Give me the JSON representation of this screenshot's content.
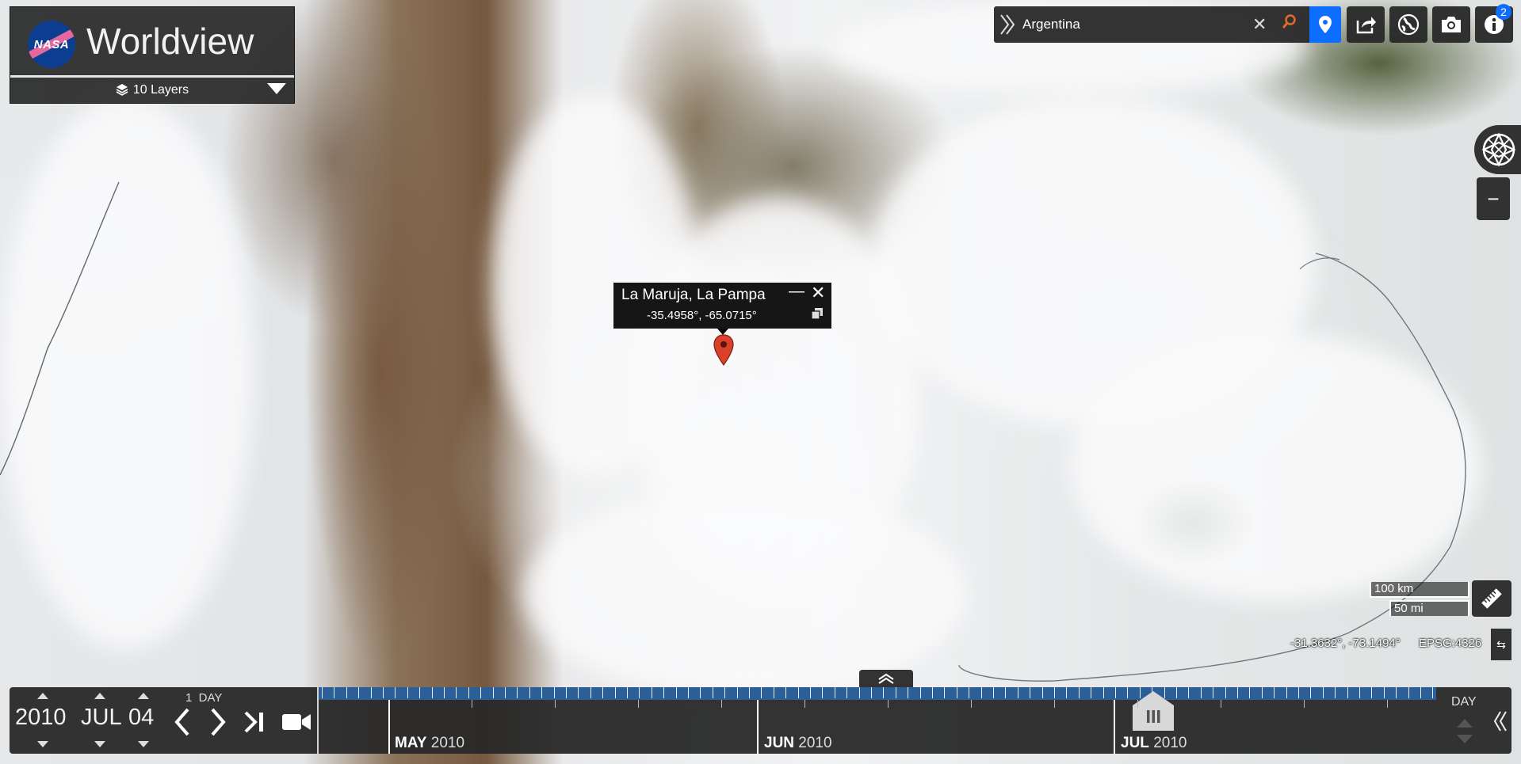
{
  "brand": {
    "logo_text": "NASA",
    "title": "Worldview",
    "layers_label": "10 Layers"
  },
  "search": {
    "value": "Argentina"
  },
  "toolbar": {
    "info_badge": "2"
  },
  "popup": {
    "place_name": "La Maruja, La Pampa",
    "coordinates": "-35.4958°, -65.0715°"
  },
  "scale": {
    "km": "100 km",
    "mi": "50 mi"
  },
  "status": {
    "mouse_coords": "-31.3632°, -73.1494°",
    "crs": "EPSG:4326"
  },
  "date": {
    "year": "2010",
    "month": "JUL",
    "day": "04",
    "interval": "1  DAY"
  },
  "timeline": {
    "zoom_level": "DAY",
    "months": [
      {
        "month": "MAY",
        "year": "2010"
      },
      {
        "month": "JUN",
        "year": "2010"
      },
      {
        "month": "JUL",
        "year": "2010"
      }
    ]
  },
  "colors": {
    "accent_blue": "#0d6efd",
    "timeline_blue": "#2c5f97",
    "marker_red": "#d9412a",
    "search_orange": "#e46a2b"
  }
}
